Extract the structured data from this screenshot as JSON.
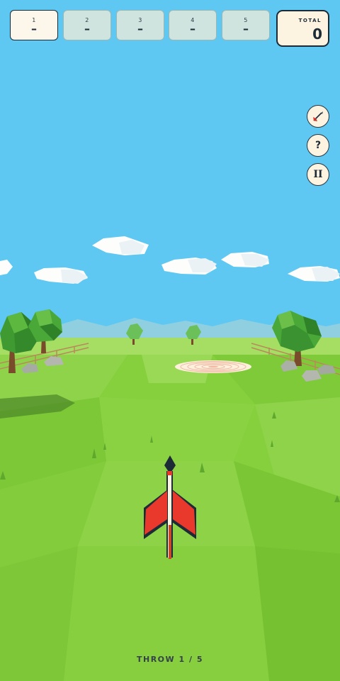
{
  "rounds": [
    {
      "number": "1",
      "score": "–",
      "active": true
    },
    {
      "number": "2",
      "score": "–",
      "active": false
    },
    {
      "number": "3",
      "score": "–",
      "active": false
    },
    {
      "number": "4",
      "score": "–",
      "active": false
    },
    {
      "number": "5",
      "score": "–",
      "active": false
    }
  ],
  "total": {
    "label": "TOTAL",
    "value": "0"
  },
  "side_buttons": [
    {
      "icon": "dart-icon"
    },
    {
      "icon": "help-icon",
      "label": "?"
    },
    {
      "icon": "pause-icon",
      "label": "II"
    }
  ],
  "status": {
    "throw_label": "THROW 1 / 5"
  },
  "colors": {
    "sky": "#5ec8f2",
    "grass": "#86d03d",
    "dart_fins": "#e8392c",
    "hud_panel": "#fdf3e1",
    "hud_border": "#1d2b36"
  }
}
